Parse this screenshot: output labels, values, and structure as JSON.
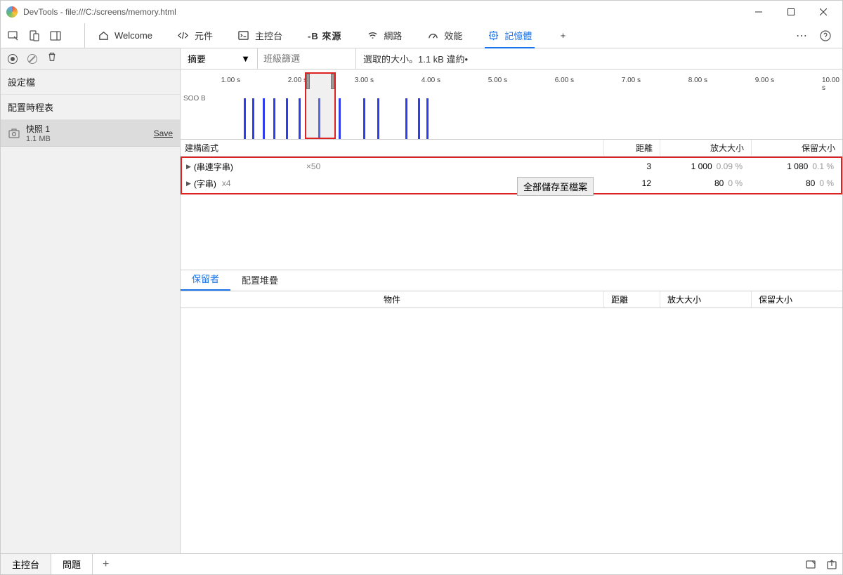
{
  "titlebar": {
    "text": "DevTools - file:///C:/screens/memory.html"
  },
  "tabs": {
    "welcome": "Welcome",
    "elements": "元件",
    "console": "主控台",
    "sources": "-B 來源",
    "network": "網路",
    "performance": "效能",
    "memory": "記憶體"
  },
  "sidebar": {
    "profiles_label": "設定檔",
    "timeline_label": "配置時程表",
    "snapshot": {
      "title": "快照 1",
      "size": "1.1 MB",
      "save": "Save"
    }
  },
  "filter": {
    "summary": "摘要",
    "class_filter_placeholder": "班級篩選",
    "status": "選取的大小。1.1 kB   違約•"
  },
  "timeline": {
    "ticks": [
      "1.00 s",
      "2.00 s",
      "3.00 s",
      "4.00 s",
      "5.00 s",
      "6.00 s",
      "7.00 s",
      "8.00 s",
      "9.00 s",
      "10.00 s"
    ],
    "ylabel": "SOO B"
  },
  "table": {
    "headers": {
      "constructor": "建構函式",
      "distance": "距離",
      "shallow": "放大大小",
      "retained": "保留大小"
    },
    "rows": [
      {
        "name": "(串連字串)",
        "mult": "×50",
        "distance": "3",
        "shallow_v": "1 000",
        "shallow_p": "0.09 %",
        "retain_v": "1 080",
        "retain_p": "0.1 %"
      },
      {
        "name": "(字串)",
        "mult": "x4",
        "distance": "12",
        "shallow_v": "80",
        "shallow_p": "0 %",
        "retain_v": "80",
        "retain_p": "0 %"
      }
    ],
    "context_menu": "全部儲存至檔案"
  },
  "retainers": {
    "tabs": {
      "retainers": "保留者",
      "stack": "配置堆疊"
    },
    "header": {
      "object": "物件",
      "distance": "距離",
      "shallow": "放大大小",
      "retained": "保留大小"
    }
  },
  "bottom": {
    "console": "主控台",
    "problemy": "問題"
  }
}
